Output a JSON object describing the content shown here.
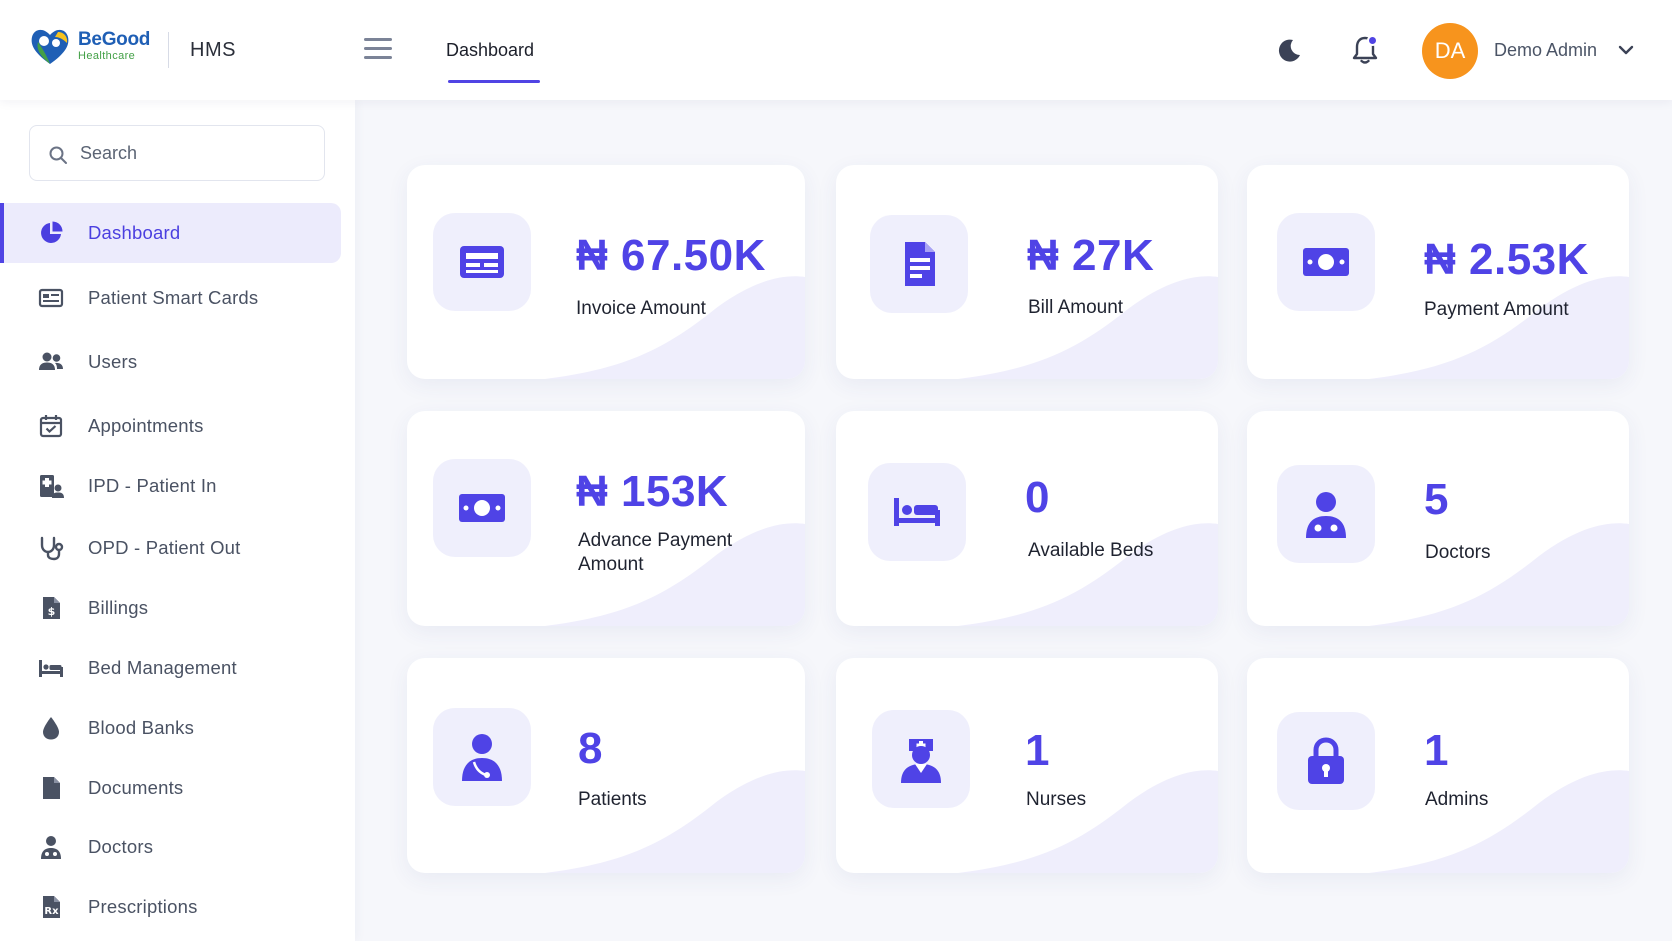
{
  "header": {
    "brand": "BeGood",
    "brand_sub": "Healthcare",
    "app_name": "HMS",
    "nav_tab": "Dashboard",
    "avatar_initials": "DA",
    "user_name": "Demo Admin",
    "accent": "#5044e4",
    "avatar_color": "#f7941d"
  },
  "sidebar": {
    "search_placeholder": "Search",
    "items": [
      {
        "label": "Dashboard",
        "icon": "pie-chart-icon",
        "active": true
      },
      {
        "label": "Patient Smart Cards",
        "icon": "id-card-icon"
      },
      {
        "label": "Users",
        "icon": "users-icon"
      },
      {
        "label": "Appointments",
        "icon": "calendar-check-icon"
      },
      {
        "label": "IPD - Patient In",
        "icon": "hospital-user-icon"
      },
      {
        "label": "OPD - Patient Out",
        "icon": "stethoscope-icon"
      },
      {
        "label": "Billings",
        "icon": "invoice-dollar-icon"
      },
      {
        "label": "Bed Management",
        "icon": "bed-icon"
      },
      {
        "label": "Blood Banks",
        "icon": "blood-drop-icon"
      },
      {
        "label": "Documents",
        "icon": "file-icon"
      },
      {
        "label": "Doctors",
        "icon": "doctor-icon"
      },
      {
        "label": "Prescriptions",
        "icon": "prescription-icon"
      }
    ]
  },
  "cards": [
    {
      "value": "₦ 67.50K",
      "label": "Invoice Amount",
      "icon": "money-card-icon"
    },
    {
      "value": "₦ 27K",
      "label": "Bill Amount",
      "icon": "file-invoice-icon"
    },
    {
      "value": "₦ 2.53K",
      "label": "Payment Amount",
      "icon": "money-bill-icon"
    },
    {
      "value": "₦ 153K",
      "label": "Advance Payment Amount",
      "icon": "money-bill-icon"
    },
    {
      "value": "0",
      "label": "Available Beds",
      "icon": "bed-icon"
    },
    {
      "value": "5",
      "label": "Doctors",
      "icon": "doctor-icon"
    },
    {
      "value": "8",
      "label": "Patients",
      "icon": "patient-icon"
    },
    {
      "value": "1",
      "label": "Nurses",
      "icon": "nurse-icon"
    },
    {
      "value": "1",
      "label": "Admins",
      "icon": "lock-icon"
    }
  ]
}
